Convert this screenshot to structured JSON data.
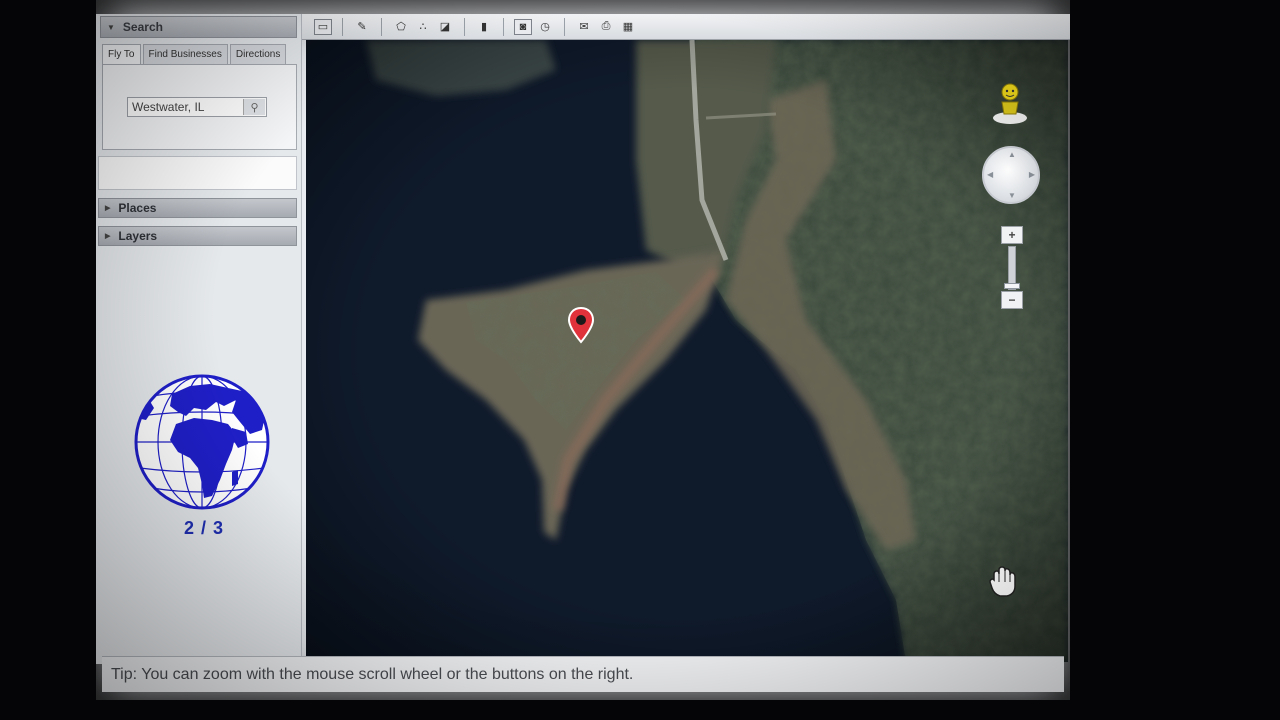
{
  "search_panel": {
    "header": "Search",
    "tabs": [
      "Fly To",
      "Find Businesses",
      "Directions"
    ],
    "fly_to_value": "Westwater, IL",
    "search_icon": "magnifier-icon"
  },
  "sidebar_sections": {
    "places": "Places",
    "layers": "Layers"
  },
  "slide": {
    "counter": "2 / 3"
  },
  "toolbar_icons": [
    "sidebar-toggle-icon",
    "placemark-icon",
    "polygon-icon",
    "path-icon",
    "overlay-icon",
    "ruler-icon",
    "record-tour-icon",
    "historical-imagery-icon",
    "email-icon",
    "print-icon",
    "view-in-maps-icon"
  ],
  "map": {
    "placemark_color": "#e0323b",
    "controls": [
      "street-view-pegman-icon",
      "navigation-ring",
      "zoom-in-button",
      "zoom-slider",
      "zoom-out-button"
    ],
    "cursor": "hand-cursor-icon"
  },
  "status_bar": {
    "tip": "Tip: You can zoom with the mouse scroll wheel or the buttons on the right."
  },
  "colors": {
    "water": "#0f1a2b",
    "land": "#6a6a57",
    "globe": "#1f1fc8"
  }
}
